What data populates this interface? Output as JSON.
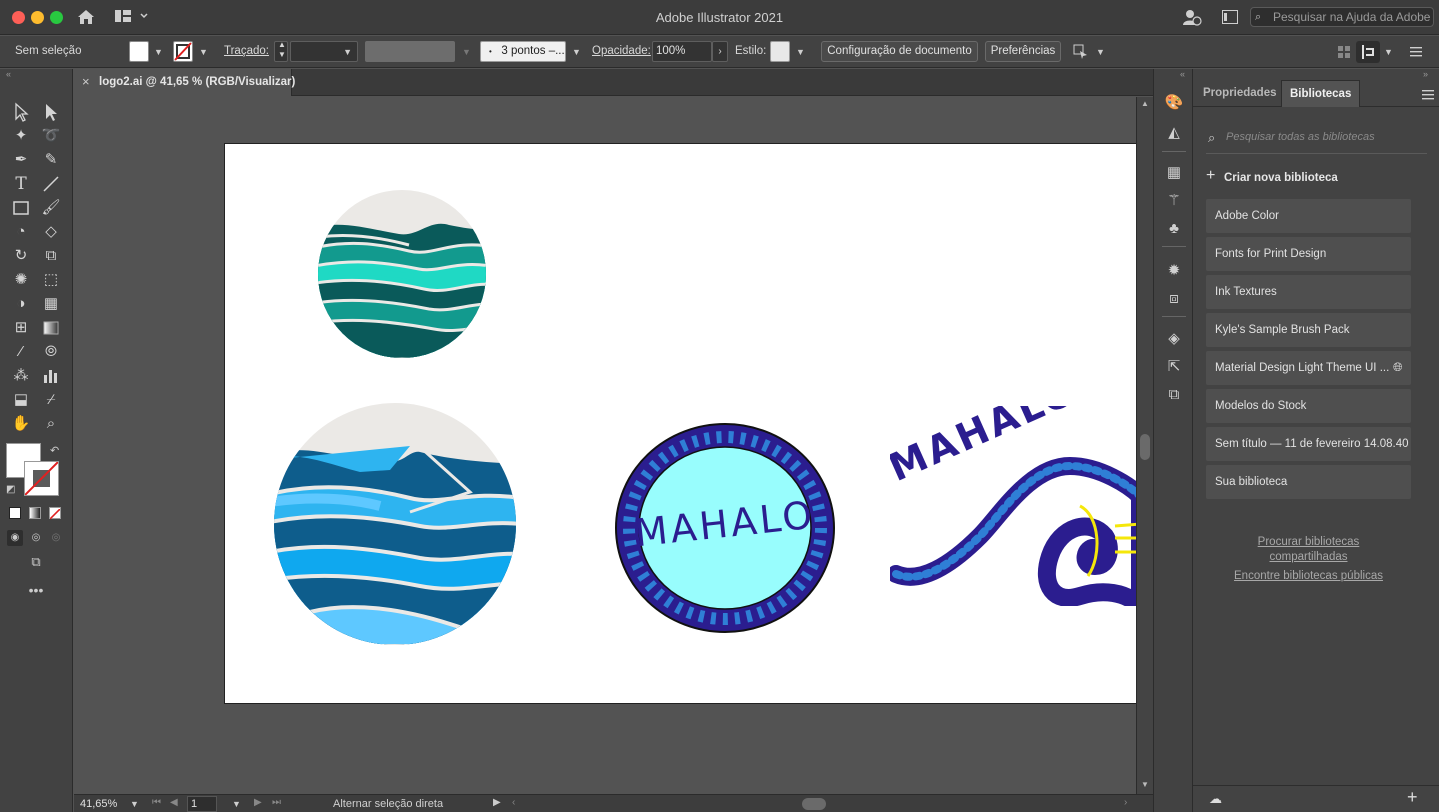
{
  "window": {
    "title": "Adobe Illustrator 2021",
    "help_search_placeholder": "Pesquisar na Ajuda da Adobe"
  },
  "control_bar": {
    "selection": "Sem seleção",
    "stroke_label": "Traçado:",
    "brush_value": "3 pontos –...",
    "opacity_label": "Opacidade:",
    "opacity_value": "100%",
    "style_label": "Estilo:",
    "document_setup_button": "Configuração de documento",
    "preferences_button": "Preferências"
  },
  "document_tab": {
    "label": "logo2.ai @ 41,65 % (RGB/Visualizar)",
    "close": "×"
  },
  "artwork": {
    "badge_text": "MAHALO",
    "arc_text": "MAHALO"
  },
  "status_bar": {
    "zoom": "41,65%",
    "artboard_number": "1",
    "message": "Alternar seleção direta"
  },
  "panel": {
    "tabs": [
      "Propriedades",
      "Bibliotecas"
    ],
    "active_tab": "Bibliotecas",
    "search_placeholder": "Pesquisar todas as bibliotecas",
    "create_library": "Criar nova biblioteca",
    "libraries": [
      "Adobe Color",
      "Fonts for Print Design",
      "Ink Textures",
      "Kyle's Sample Brush Pack",
      "Material Design Light Theme UI ...",
      "Modelos do Stock",
      "Sem título — 11 de fevereiro 14.08.40",
      "Sua biblioteca"
    ],
    "browse_shared_line1": "Procurar bibliotecas",
    "browse_shared_line2": "compartilhadas",
    "find_public": "Encontre bibliotecas públicas"
  },
  "colors": {
    "traffic_close": "#fe5f57",
    "traffic_min": "#febc2e",
    "traffic_max": "#28c840",
    "teal_dark": "#0a5a5a",
    "teal_mid": "#129a8e",
    "teal_light": "#1fd9c4",
    "blue_dark": "#0e5d8c",
    "blue_mid": "#2eb4f0",
    "blue_light": "#5ec8ff",
    "badge_purple": "#2b1d8f",
    "badge_cyan": "#98fdfd",
    "sky": "#ebe9e6"
  }
}
